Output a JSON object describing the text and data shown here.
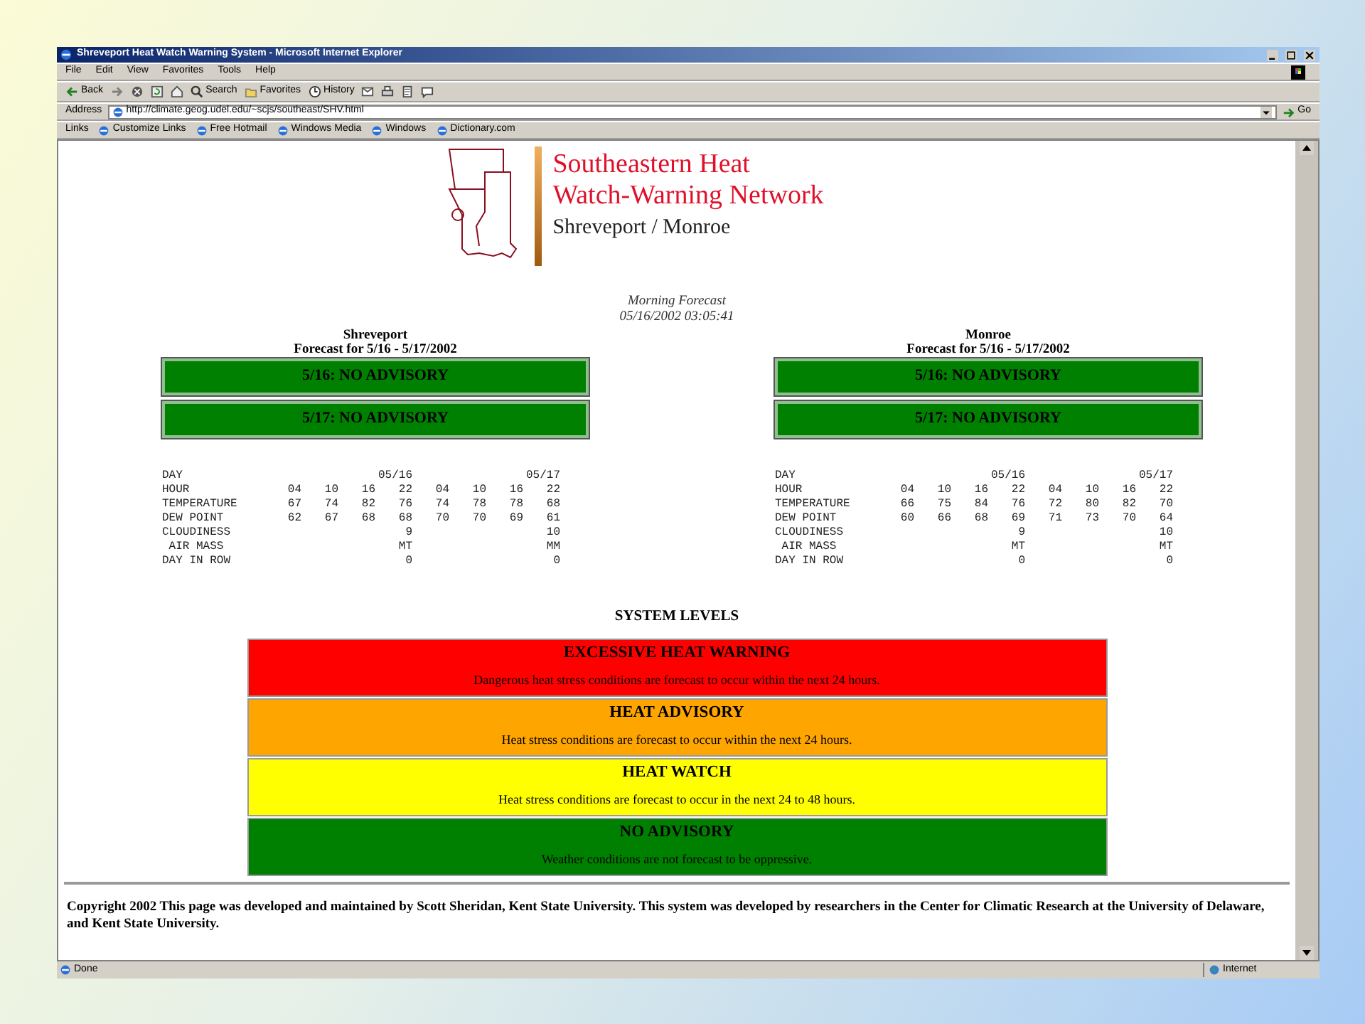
{
  "window": {
    "title": "Shreveport Heat Watch Warning System - Microsoft Internet Explorer"
  },
  "menu": [
    "File",
    "Edit",
    "View",
    "Favorites",
    "Tools",
    "Help"
  ],
  "toolbar": [
    {
      "kind": "back",
      "label": "Back"
    },
    {
      "kind": "forward"
    },
    {
      "kind": "stop"
    },
    {
      "kind": "refresh"
    },
    {
      "kind": "home"
    },
    {
      "kind": "search",
      "label": "Search"
    },
    {
      "kind": "favorites",
      "label": "Favorites"
    },
    {
      "kind": "history",
      "label": "History"
    },
    {
      "kind": "mail"
    },
    {
      "kind": "print"
    },
    {
      "kind": "edit"
    },
    {
      "kind": "discuss"
    }
  ],
  "address_bar": {
    "label": "Address",
    "url": "http://climate.geog.udel.edu/~scjs/southeast/SHV.html",
    "go": "Go"
  },
  "links_bar": {
    "label": "Links",
    "links": [
      "Customize Links",
      "Free Hotmail",
      "Windows Media",
      "Windows",
      "Dictionary.com"
    ]
  },
  "page": {
    "logo": {
      "title_lines": [
        "Southeastern Heat",
        "Watch-Warning Network"
      ],
      "subtitle": "Shreveport / Monroe"
    },
    "forecast_type": "Morning Forecast",
    "issued": "05/16/2002 03:05:41",
    "cities": [
      {
        "name": "Shreveport",
        "period": "Forecast for 5/16 - 5/17/2002",
        "advisories": [
          {
            "text": "5/16: NO ADVISORY",
            "color": "#008000"
          },
          {
            "text": "5/17: NO ADVISORY",
            "color": "#008000"
          }
        ],
        "table": [
          {
            "label": "DAY",
            "kind": "daily",
            "values": [
              "05/16",
              "05/17"
            ]
          },
          {
            "label": "HOUR",
            "kind": "hourly",
            "values": [
              "04",
              "10",
              "16",
              "22",
              "04",
              "10",
              "16",
              "22"
            ]
          },
          {
            "label": "TEMPERATURE",
            "kind": "hourly",
            "values": [
              "67",
              "74",
              "82",
              "76",
              "74",
              "78",
              "78",
              "68"
            ]
          },
          {
            "label": "DEW POINT",
            "kind": "hourly",
            "values": [
              "62",
              "67",
              "68",
              "68",
              "70",
              "70",
              "69",
              "61"
            ]
          },
          {
            "label": "CLOUDINESS",
            "kind": "daily",
            "values": [
              "9",
              "10"
            ]
          },
          {
            "label": " AIR MASS",
            "kind": "daily",
            "values": [
              "MT",
              "MM"
            ]
          },
          {
            "label": "DAY IN ROW",
            "kind": "daily",
            "values": [
              "0",
              "0"
            ]
          }
        ]
      },
      {
        "name": "Monroe",
        "period": "Forecast for 5/16 - 5/17/2002",
        "advisories": [
          {
            "text": "5/16: NO ADVISORY",
            "color": "#008000"
          },
          {
            "text": "5/17: NO ADVISORY",
            "color": "#008000"
          }
        ],
        "table": [
          {
            "label": "DAY",
            "kind": "daily",
            "values": [
              "05/16",
              "05/17"
            ]
          },
          {
            "label": "HOUR",
            "kind": "hourly",
            "values": [
              "04",
              "10",
              "16",
              "22",
              "04",
              "10",
              "16",
              "22"
            ]
          },
          {
            "label": "TEMPERATURE",
            "kind": "hourly",
            "values": [
              "66",
              "75",
              "84",
              "76",
              "72",
              "80",
              "82",
              "70"
            ]
          },
          {
            "label": "DEW POINT",
            "kind": "hourly",
            "values": [
              "60",
              "66",
              "68",
              "69",
              "71",
              "73",
              "70",
              "64"
            ]
          },
          {
            "label": "CLOUDINESS",
            "kind": "daily",
            "values": [
              "9",
              "10"
            ]
          },
          {
            "label": " AIR MASS",
            "kind": "daily",
            "values": [
              "MT",
              "MT"
            ]
          },
          {
            "label": "DAY IN ROW",
            "kind": "daily",
            "values": [
              "0",
              "0"
            ]
          }
        ]
      }
    ],
    "system_levels": {
      "title": "SYSTEM LEVELS",
      "levels": [
        {
          "name": "EXCESSIVE HEAT WARNING",
          "description": "Dangerous heat stress conditions are forecast to occur within the next 24 hours.",
          "color": "#ff0000"
        },
        {
          "name": "HEAT ADVISORY",
          "description": "Heat stress conditions are forecast to occur within the next 24 hours.",
          "color": "#ffa500"
        },
        {
          "name": "HEAT WATCH",
          "description": "Heat stress conditions are forecast to occur in the next 24 to 48 hours.",
          "color": "#ffff00"
        },
        {
          "name": "NO ADVISORY",
          "description": "Weather conditions are not forecast to be oppressive.",
          "color": "#008000"
        }
      ]
    },
    "footer": "Copyright 2002 This page was developed and maintained by Scott Sheridan, Kent State University. This system was developed by researchers in the Center for Climatic Research at the University of Delaware, and Kent State University."
  },
  "status_bar": {
    "status": "Done",
    "zone": "Internet"
  }
}
